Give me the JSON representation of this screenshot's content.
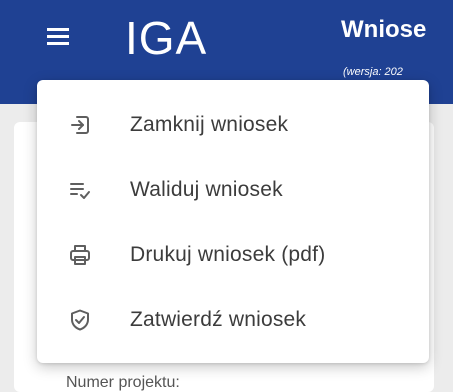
{
  "header": {
    "logo": "IGA",
    "title": "Wniose",
    "subtitle": "(wersja: 202"
  },
  "form": {
    "project_number_label": "Numer projektu:"
  },
  "menu": {
    "items": [
      {
        "label": "Zamknij wniosek",
        "icon": "exit-to-app-icon"
      },
      {
        "label": "Waliduj wniosek",
        "icon": "list-check-icon"
      },
      {
        "label": "Drukuj wniosek (pdf)",
        "icon": "printer-icon"
      },
      {
        "label": "Zatwierdź wniosek",
        "icon": "shield-check-icon"
      }
    ]
  },
  "colors": {
    "header_bg": "#1f4193",
    "icon": "#5f5f5f",
    "text": "#3c3c3c"
  }
}
